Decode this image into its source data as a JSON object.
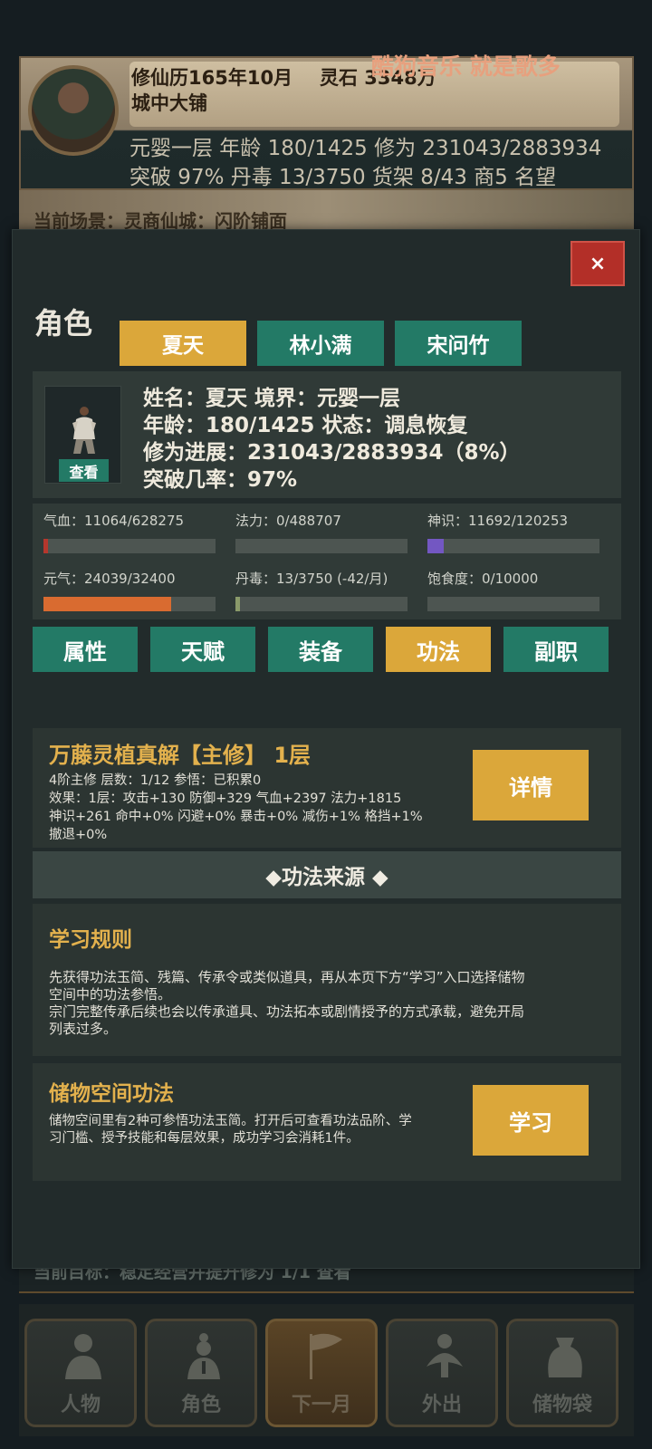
{
  "overlay": {
    "music_text": "酷狗音乐  就是歌多"
  },
  "hud": {
    "date": "修仙历165年10月",
    "lingshi": "灵石 3348万",
    "location": "城中大铺",
    "row3": "元婴一层    年龄 180/1425    修为 231043/2883934",
    "row4": "突破 97%   丹毒 13/3750   货架 8/43   商5   名望"
  },
  "scene": {
    "text": "当前场景：灵商仙城：闪阶铺面"
  },
  "goal": {
    "text": "当前目标：稳定经营并提升修为 1/1    查看"
  },
  "bottom_nav": [
    {
      "label": "人物",
      "icon": "person-icon"
    },
    {
      "label": "角色",
      "icon": "character-icon"
    },
    {
      "label": "下一月",
      "icon": "flag-icon"
    },
    {
      "label": "外出",
      "icon": "travel-icon"
    },
    {
      "label": "储物袋",
      "icon": "bag-icon"
    }
  ],
  "modal": {
    "close_label": "×",
    "title": "角色",
    "character_tabs": [
      "夏天",
      "林小满",
      "宋问竹"
    ],
    "active_character": 0,
    "profile": {
      "view_label": "查看",
      "line1": "姓名：夏天    境界：元婴一层",
      "line2": "年龄：180/1425    状态：调息恢复",
      "line3": "修为进展：231043/2883934（8%）",
      "line4": "突破几率：97%"
    },
    "stats": [
      {
        "label": "气血：11064/628275",
        "fraction": 0.0176,
        "color": "#b5372d"
      },
      {
        "label": "法力：0/488707",
        "fraction": 0.0,
        "color": "#3d6fb5"
      },
      {
        "label": "神识：11692/120253",
        "fraction": 0.0972,
        "color": "#7357c2"
      },
      {
        "label": "元气：24039/32400",
        "fraction": 0.742,
        "color": "#d96b30"
      },
      {
        "label": "丹毒：13/3750 (-42/月)",
        "fraction": 0.0035,
        "color": "#8a9a6a"
      },
      {
        "label": "饱食度：0/10000",
        "fraction": 0.0,
        "color": "#c9a13a"
      }
    ],
    "sub_tabs": [
      "属性",
      "天赋",
      "装备",
      "功法",
      "副职"
    ],
    "active_sub_tab": 3,
    "main_skill": {
      "title": "万藤灵植真解【主修】 1层",
      "line1": "4阶主修    层数：1/12    参悟：已积累0",
      "line2": "效果：1层：攻击+130 防御+329 气血+2397 法力+1815",
      "line3": "神识+261 命中+0% 闪避+0% 暴击+0% 减伤+1% 格挡+1%",
      "line4": "撤退+0%",
      "button": "详情"
    },
    "source_header": "◆功法来源 ◆",
    "rules": {
      "title": "学习规则",
      "line1": "先获得功法玉简、残篇、传承令或类似道具，再从本页下方“学习”入口选择储物",
      "line2": "空间中的功法参悟。",
      "line3": "宗门完整传承后续也会以传承道具、功法拓本或剧情授予的方式承载，避免开局",
      "line4": "列表过多。"
    },
    "storage": {
      "title": "储物空间功法",
      "line1": "储物空间里有2种可参悟功法玉简。打开后可查看功法品阶、学",
      "line2": "习门槛、授予技能和每层效果，成功学习会消耗1件。",
      "button": "学习"
    }
  }
}
